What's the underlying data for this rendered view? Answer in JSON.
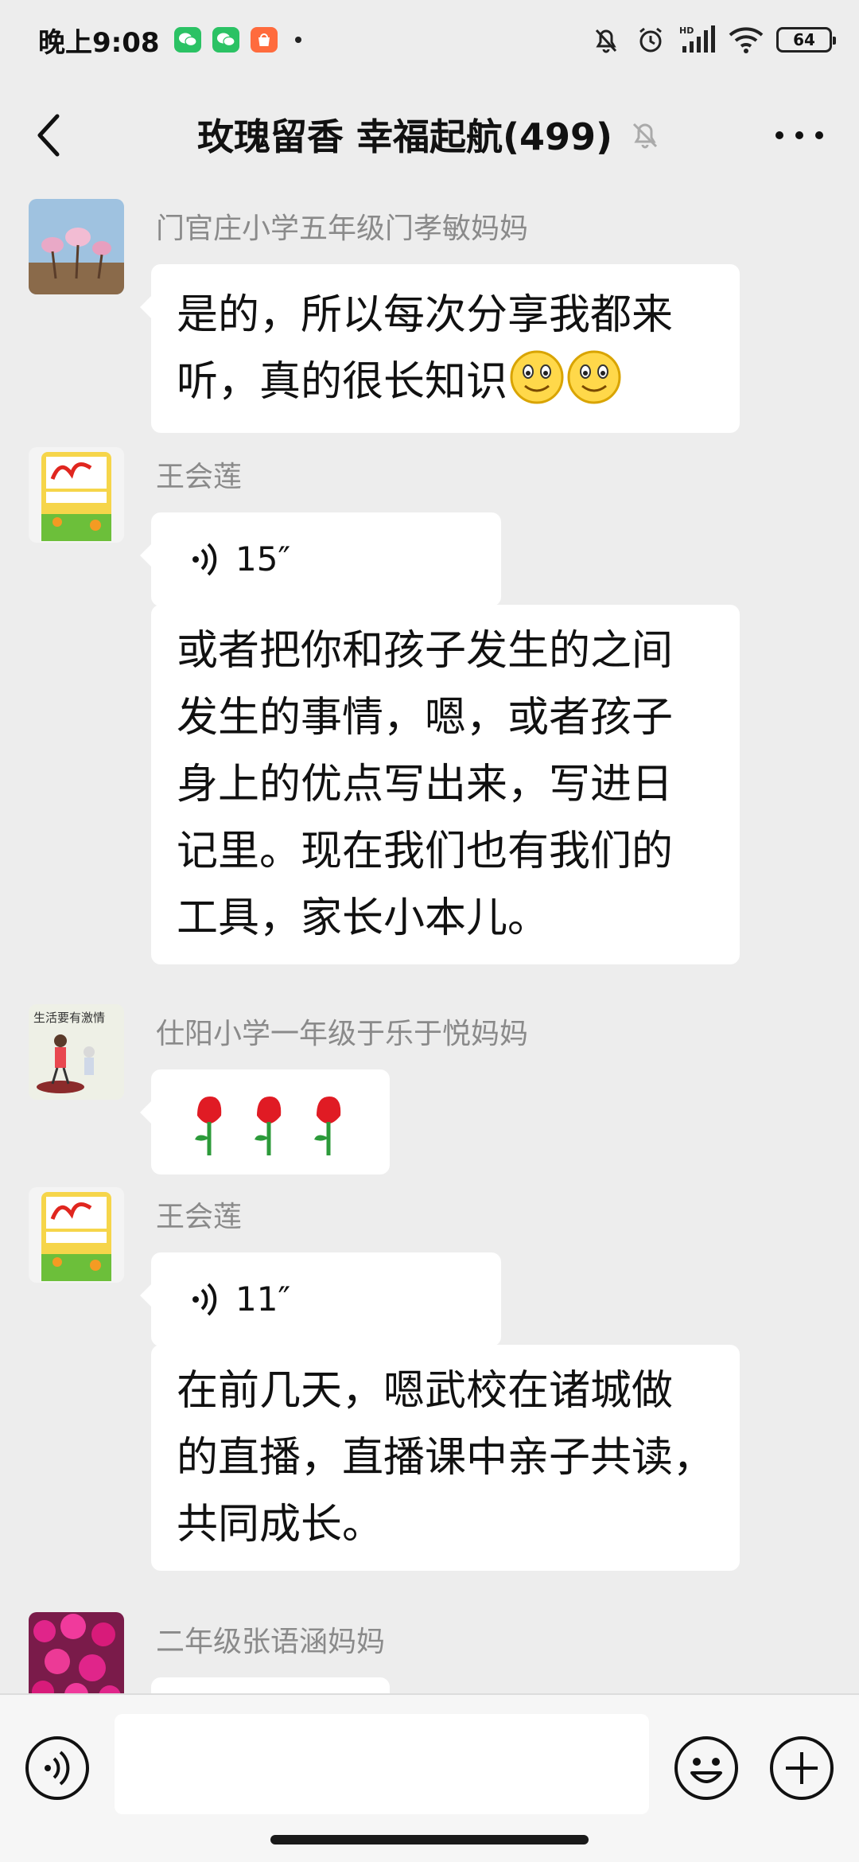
{
  "status_bar": {
    "time": "晚上9:08",
    "battery": "64",
    "network": "HD"
  },
  "header": {
    "title": "玫瑰留香  幸福起航(499)"
  },
  "messages": [
    {
      "sender": "门官庄小学五年级门孝敏妈妈",
      "lines": [
        "是的，所以每次分享我都来",
        "听，真的很长知识"
      ]
    },
    {
      "sender": "王会莲",
      "voice_duration": "15″"
    },
    {
      "lines": [
        "或者把你和孩子发生的之间",
        "发生的事情，嗯，或者孩子",
        "身上的优点写出来，写进日",
        "记里。现在我们也有我们的",
        "工具，家长小本儿。"
      ]
    },
    {
      "sender": "仕阳小学一年级于乐于悦妈妈",
      "emoji": "🌹🌹🌹"
    },
    {
      "sender": "王会莲",
      "voice_duration": "11″"
    },
    {
      "lines": [
        "在前几天，嗯武校在诸城做",
        "的直播，直播课中亲子共读，",
        "共同成长。"
      ]
    },
    {
      "sender": "二年级张语涵妈妈"
    }
  ],
  "avatar_caption": "生活要有激情",
  "colors": {
    "background": "#ededed",
    "bubble": "#ffffff",
    "sender_name": "#8a8a8a",
    "wechat_green": "#2bc264"
  }
}
